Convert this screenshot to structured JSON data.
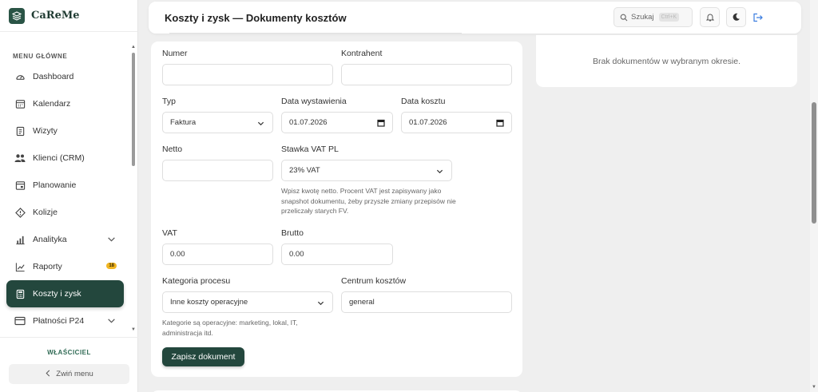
{
  "app": {
    "name": "CaReMe"
  },
  "sidebar": {
    "section_label": "MENU GŁÓWNE",
    "items": [
      {
        "label": "Dashboard",
        "icon": "gauge-icon"
      },
      {
        "label": "Kalendarz",
        "icon": "calendar-icon"
      },
      {
        "label": "Wizyty",
        "icon": "clipboard-icon"
      },
      {
        "label": "Klienci (CRM)",
        "icon": "users-icon"
      },
      {
        "label": "Planowanie",
        "icon": "planner-icon"
      },
      {
        "label": "Kolizje",
        "icon": "alert-diamond-icon"
      },
      {
        "label": "Analityka",
        "icon": "bar-chart-icon"
      },
      {
        "label": "Raporty",
        "icon": "trend-icon",
        "badge": "18"
      },
      {
        "label": "Koszty i zysk",
        "icon": "calculator-icon",
        "active": true
      },
      {
        "label": "Płatności P24",
        "icon": "card-icon"
      }
    ],
    "role": "WŁAŚCICIEL",
    "collapse_label": "Zwiń menu"
  },
  "header": {
    "title": "Koszty i zysk — Dokumenty kosztów",
    "search_label": "Szukaj",
    "search_shortcut": "Ctrl+K"
  },
  "form": {
    "numer_label": "Numer",
    "numer_value": "",
    "kontrahent_label": "Kontrahent",
    "kontrahent_value": "",
    "typ_label": "Typ",
    "typ_value": "Faktura",
    "data_wyst_label": "Data wystawienia",
    "data_wyst_value": "01.07.2026",
    "data_kosztu_label": "Data kosztu",
    "data_kosztu_value": "01.07.2026",
    "netto_label": "Netto",
    "netto_value": "",
    "stawka_label": "Stawka VAT PL",
    "stawka_value": "23% VAT",
    "stawka_hint": "Wpisz kwotę netto. Procent VAT jest zapisywany jako snapshot dokumentu, żeby przyszłe zmiany przepisów nie przeliczały starych FV.",
    "vat_label": "VAT",
    "vat_value": "0.00",
    "brutto_label": "Brutto",
    "brutto_value": "0.00",
    "kategoria_label": "Kategoria procesu",
    "kategoria_value": "Inne koszty operacyjne",
    "kategoria_hint": "Kategorie są operacyjne: marketing, lokal, IT, administracja itd.",
    "centrum_label": "Centrum kosztów",
    "centrum_value": "general",
    "submit_label": "Zapisz dokument"
  },
  "documents": {
    "empty_message": "Brak dokumentów w wybranym okresie."
  },
  "colors": {
    "accent": "#23473d",
    "badge": "#f1b623",
    "logout": "#3b7de0"
  }
}
